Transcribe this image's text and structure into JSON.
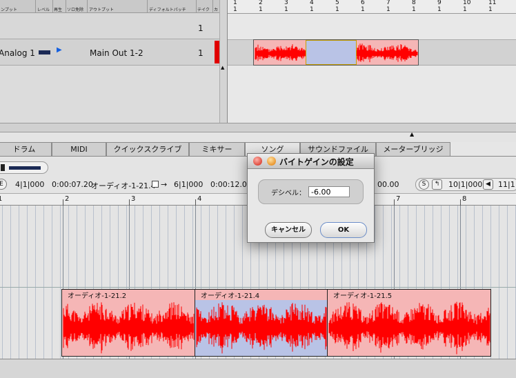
{
  "track_list": {
    "columns": [
      "ンプット",
      "レベル",
      "再生",
      "ソロ免除",
      "アウトプット",
      "ディフォルトパッチ",
      "テイク",
      "カ"
    ],
    "rows": [
      {
        "input": "",
        "output": "",
        "take": "1"
      },
      {
        "input": "Analog 1",
        "output": "Main Out 1-2",
        "take": "1"
      }
    ],
    "scroll_up": "▲",
    "scroll_right": "▶",
    "scroll_left": "◀"
  },
  "top_ruler": {
    "measures": [
      "1",
      "2",
      "3",
      "4",
      "5",
      "6",
      "7",
      "8",
      "9",
      "10",
      "11"
    ],
    "beats": [
      "1",
      "1",
      "1",
      "1",
      "1",
      "1",
      "1",
      "1",
      "1",
      "1",
      "1"
    ]
  },
  "tabs": [
    "ドラム",
    "MIDI",
    "クイックスクライブ",
    "ミキサー",
    "ソング",
    "サウンドファイル",
    "メーターブリッジ"
  ],
  "toolbar": {
    "start_pos": "4|1|000",
    "start_time": "0:00:07.20",
    "clip_name": "オーディオ-1-21.4",
    "end_pos": "6|1|000",
    "end_time": "0:00:12.00",
    "duration": "00.00",
    "s_button": "S",
    "loop_pos": "10|1|000",
    "loop_end_pos": "11|1",
    "e_button": "E",
    "arrow": "→"
  },
  "editor_ruler": {
    "measures": [
      "1",
      "2",
      "3",
      "4",
      "7",
      "8"
    ]
  },
  "clips": [
    {
      "name": "オーディオ-1-21.2"
    },
    {
      "name": "オーディオ-1-21.4"
    },
    {
      "name": "オーディオ-1-21.5"
    }
  ],
  "dialog": {
    "title": "バイトゲインの設定",
    "label": "デシベル：",
    "value": "-6.00",
    "cancel": "キャンセル",
    "ok": "OK"
  },
  "colors": {
    "clip_fill": "#f5b6b6",
    "waveform": "#ff0000",
    "selection": "#b9c3e6",
    "dialog_ok_border": "#6a8cc7"
  },
  "icons": [
    "close-button-red",
    "minimize-button-yellow",
    "play-triangle-icon",
    "loop-back-icon",
    "rewind-arrow-icon"
  ]
}
